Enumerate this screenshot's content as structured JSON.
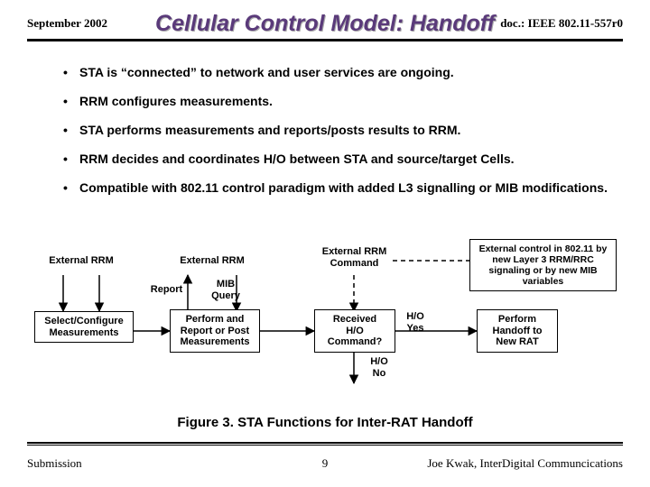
{
  "header": {
    "left": "September 2002",
    "right": "doc.: IEEE 802.11-557r0"
  },
  "title": "Cellular Control Model:  Handoff",
  "bullets": [
    "STA is “connected” to network and user services are ongoing.",
    "RRM configures measurements.",
    "STA performs measurements and reports/posts results to RRM.",
    "RRM decides and coordinates H/O between STA and source/target Cells.",
    "Compatible with 802.11 control paradigm with added L3 signalling or MIB modifications."
  ],
  "diagram": {
    "label_ext_rrm_1": "External RRM",
    "label_ext_rrm_2": "External RRM",
    "label_ext_rrm_cmd": "External RRM\nCommand",
    "label_ext_ctrl": "External control in 802.11 by new Layer 3 RRM/RRC signaling or by new MIB variables",
    "label_report": "Report",
    "label_mib_query": "MIB\nQuery",
    "box_select": "Select/Configure\nMeasurements",
    "box_perform": "Perform and\nReport or Post\nMeasurements",
    "box_received": "Received\nH/O\nCommand?",
    "label_ho_yes": "H/O\nYes",
    "box_handoff": "Perform\nHandoff to\nNew RAT",
    "label_ho_no": "H/O\nNo"
  },
  "figure_caption": "Figure 3.  STA Functions for Inter-RAT Handoff",
  "footer": {
    "left": "Submission",
    "center": "9",
    "right": "Joe Kwak, InterDigital Communcications"
  }
}
